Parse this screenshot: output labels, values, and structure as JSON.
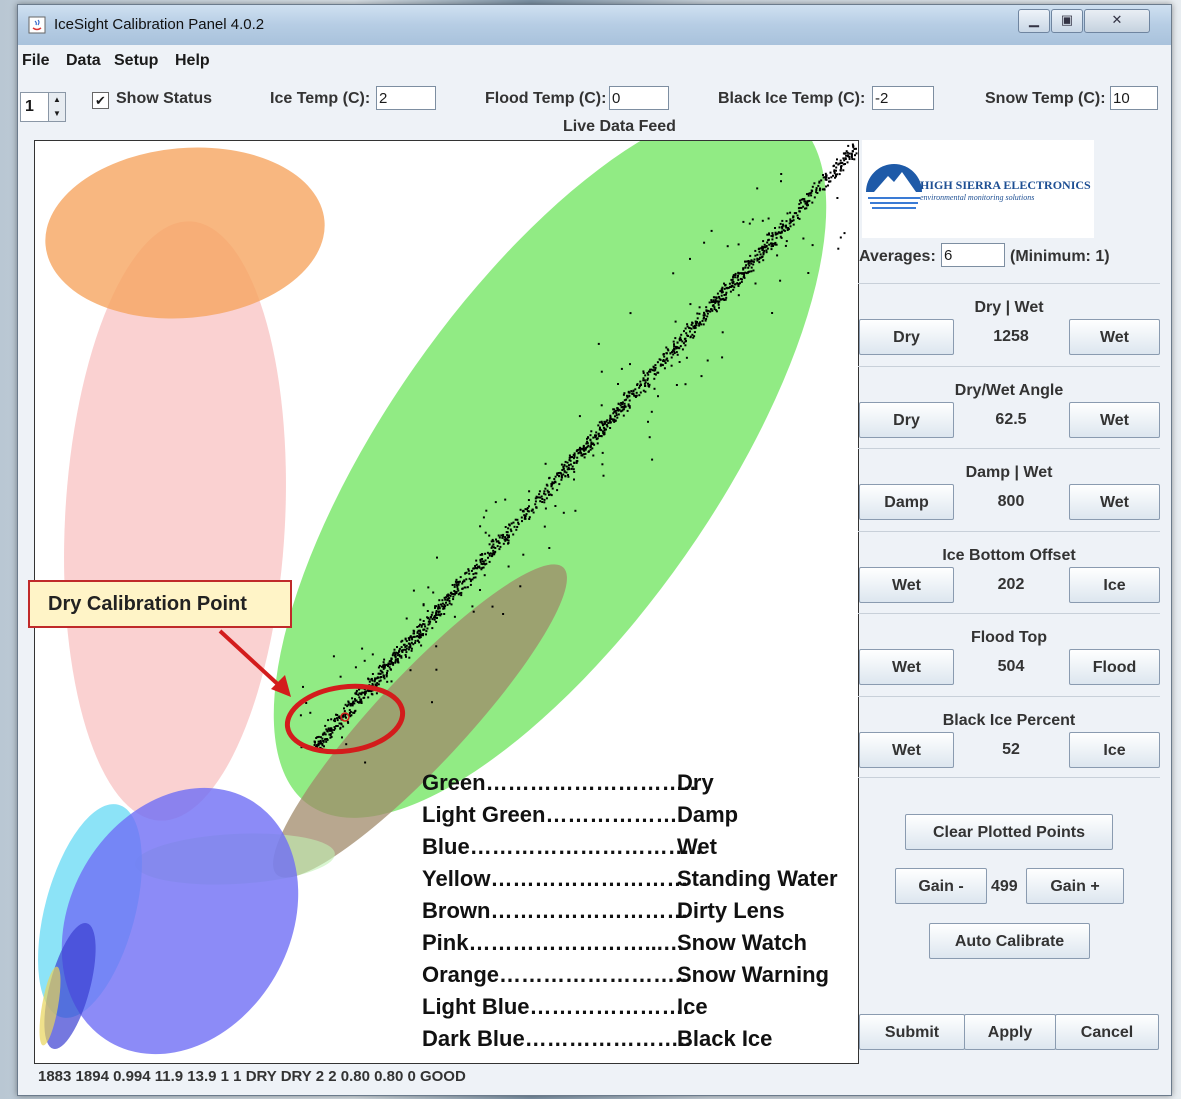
{
  "window": {
    "title": "IceSight Calibration Panel 4.0.2"
  },
  "menu": [
    "File",
    "Data",
    "Setup",
    "Help"
  ],
  "toolbar": {
    "spinner_value": "1",
    "show_status_label": "Show Status",
    "show_status_checked": true,
    "ice_temp_label": "Ice Temp (C):",
    "ice_temp_value": "2",
    "flood_temp_label": "Flood Temp (C):",
    "flood_temp_value": "0",
    "black_ice_temp_label": "Black Ice Temp (C):",
    "black_ice_temp_value": "-2",
    "snow_temp_label": "Snow Temp (C):",
    "snow_temp_value": "10",
    "live_feed_label": "Live Data Feed"
  },
  "logo": {
    "name": "HIGH SIERRA ELECTRONICS",
    "tagline": "environmental monitoring solutions"
  },
  "averages": {
    "label": "Averages:",
    "value": "6",
    "minimum_label": "(Minimum: 1)"
  },
  "sections": [
    {
      "title": "Dry | Wet",
      "left": "Dry",
      "value": "1258",
      "right": "Wet"
    },
    {
      "title": "Dry/Wet Angle",
      "left": "Dry",
      "value": "62.5",
      "right": "Wet"
    },
    {
      "title": "Damp | Wet",
      "left": "Damp",
      "value": "800",
      "right": "Wet"
    },
    {
      "title": "Ice Bottom Offset",
      "left": "Wet",
      "value": "202",
      "right": "Ice"
    },
    {
      "title": "Flood Top",
      "left": "Wet",
      "value": "504",
      "right": "Flood"
    },
    {
      "title": "Black Ice Percent",
      "left": "Wet",
      "value": "52",
      "right": "Ice"
    }
  ],
  "controls": {
    "clear_label": "Clear Plotted Points",
    "gain_minus_label": "Gain -",
    "gain_value": "499",
    "gain_plus_label": "Gain +",
    "auto_calibrate_label": "Auto Calibrate",
    "submit_label": "Submit",
    "apply_label": "Apply",
    "cancel_label": "Cancel"
  },
  "callout": "Dry Calibration Point",
  "legend": [
    {
      "color": "Green",
      "dots": "………………………..",
      "meaning": "Dry"
    },
    {
      "color": "Light Green",
      "dots": "……………….",
      "meaning": "Damp"
    },
    {
      "color": "Blue",
      "dots": "…………………………..",
      "meaning": "Wet"
    },
    {
      "color": "Yellow",
      "dots": "………………………",
      "meaning": "Standing Water"
    },
    {
      "color": "Brown",
      "dots": "………………………",
      "meaning": "Dirty Lens"
    },
    {
      "color": "Pink",
      "dots": "……………………...…",
      "meaning": "Snow Watch"
    },
    {
      "color": "Orange",
      "dots": "……………………..",
      "meaning": "Snow Warning"
    },
    {
      "color": "Light Blue",
      "dots": "………………….",
      "meaning": "Ice"
    },
    {
      "color": "Dark Blue",
      "dots": "…………………..",
      "meaning": "Black Ice"
    }
  ],
  "region_colors": {
    "green": "#7ee86e",
    "light_green": "#bff0b3",
    "blue": "#6f6ef5",
    "yellow": "#e8d45a",
    "brown": "#a08a6a",
    "pink": "#f7b9b9",
    "orange": "#f6a560",
    "light_blue": "#6fdcf5",
    "dark_blue": "#3b3fd1"
  },
  "status_line": "1883  1894  0.994   11.9   13.9 1 1 DRY DRY 2 2 0.80 0.80 0 GOOD"
}
